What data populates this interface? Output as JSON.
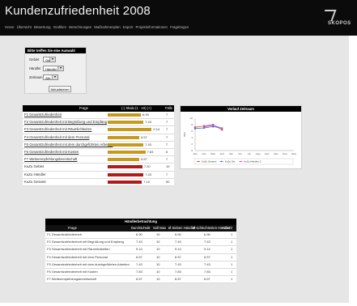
{
  "header": {
    "title": "Kundenzufriedenheit 2008",
    "nav": [
      "Home",
      "Übersicht",
      "Bewertung",
      "Grafiken",
      "Berechnungen",
      "Maßnahmenplan",
      "Export",
      "Projektinformationen",
      "Fragebogen"
    ],
    "logo_text": "SKOPOS"
  },
  "filter": {
    "heading": "Bitte treffen Sie eine Auswahl",
    "rows": [
      {
        "label": "Gebiet",
        "value": "Ost"
      },
      {
        "label": "Händler",
        "value": "Händler C"
      },
      {
        "label": "Zeitraum",
        "value": "Alle"
      }
    ],
    "button": "Aktualisieren"
  },
  "table1": {
    "headers": [
      "Frage",
      "(-) Skala (1 - 10) (+)",
      "Fälle"
    ],
    "rows": [
      {
        "q": "F1 Gesamtzufriedenheit",
        "v": "6.90",
        "n": "7",
        "color": "gold",
        "link": true
      },
      {
        "q": "F2 Gesamtzufriedenheit mit Begrüßung und Empfang",
        "v": "7.43",
        "n": "7",
        "color": "gold",
        "link": true
      },
      {
        "q": "F3 Gesamtzufriedenheit mit Räumlichkeiten",
        "v": "9.14",
        "n": "7",
        "color": "gold",
        "link": true
      },
      {
        "q": "F4 Gesamtzufriedenheit mit dem Personal",
        "v": "6.57",
        "n": "7",
        "color": "gold",
        "link": true
      },
      {
        "q": "F5 Gesamtzufriedenheit mit dem durchgeführten Arbeiten",
        "v": "7.43",
        "n": "7",
        "color": "gold",
        "link": true
      },
      {
        "q": "F6 Gesamtzufriedenheit mit Kosten",
        "v": "7.83",
        "n": "6",
        "color": "gold",
        "link": true
      },
      {
        "q": "F7 Weiterempfehlungsbereitschaft",
        "v": "6.57",
        "n": "7",
        "color": "gold",
        "link": true
      },
      {
        "q": "KuZu Gebiet",
        "v": "7.20",
        "n": "19",
        "color": "red",
        "link": false
      },
      {
        "q": "KuZu Händler",
        "v": "7.43",
        "n": "7",
        "color": "red",
        "link": false
      },
      {
        "q": "KuZu Gesamt",
        "v": "7.10",
        "n": "50",
        "color": "red",
        "link": false
      }
    ]
  },
  "chart_data": {
    "type": "line",
    "title": "Verlauf Zeitraum",
    "ylabel": "Wert",
    "categories": [
      "Januar",
      "Februar",
      "März",
      "April",
      "Mai",
      "Juni",
      "Juli",
      "August",
      "September",
      "Oktober",
      "November",
      "Dezember"
    ],
    "ylim": [
      0,
      10
    ],
    "series": [
      {
        "name": "KuZu Gesamt",
        "color": "#d9534f",
        "values": [
          7.2,
          7.6,
          8.0,
          6.4,
          null,
          null,
          null,
          null,
          null,
          null,
          null,
          null
        ]
      },
      {
        "name": "KuZu Ost",
        "color": "#3a6fd8",
        "values": [
          6.8,
          7.0,
          7.4,
          6.9,
          null,
          null,
          null,
          null,
          null,
          null,
          null,
          null
        ]
      },
      {
        "name": "KuZu Händler C",
        "color": "#b25bd8",
        "values": [
          null,
          7.3,
          7.8,
          6.9,
          null,
          null,
          null,
          null,
          null,
          null,
          null,
          null
        ]
      }
    ]
  },
  "table2": {
    "caption": "Händlerbetrachtung",
    "headers": [
      "Frage",
      "Durchschnitt",
      "Soll Max",
      "Ø Sieben Händler",
      "Ø schlechtesten Händler",
      "Anzahl Händler"
    ],
    "rows": [
      [
        "F1 Gesamtzufriedenheit",
        "6.90",
        "10",
        "6.90",
        "6.90",
        "1"
      ],
      [
        "F2 Gesamtzufriedenheit mit Begrüßung und Empfang",
        "7.43",
        "10",
        "7.43",
        "7.43",
        "1"
      ],
      [
        "F3 Gesamtzufriedenheit mit Räumlichkeiten",
        "9.14",
        "10",
        "9.14",
        "9.14",
        "1"
      ],
      [
        "F4 Gesamtzufriedenheit mit dem Personal",
        "6.57",
        "10",
        "6.57",
        "6.57",
        "1"
      ],
      [
        "F5 Gesamtzufriedenheit mit dem durchgeführten Arbeiten",
        "7.43",
        "10",
        "7.43",
        "7.43",
        "1"
      ],
      [
        "F6 Gesamtzufriedenheit mit Kosten",
        "7.83",
        "10",
        "7.83",
        "7.83",
        "1"
      ],
      [
        "F7 Weiterempfehlungsbereitschaft",
        "6.57",
        "10",
        "6.57",
        "6.57",
        "1"
      ]
    ]
  }
}
